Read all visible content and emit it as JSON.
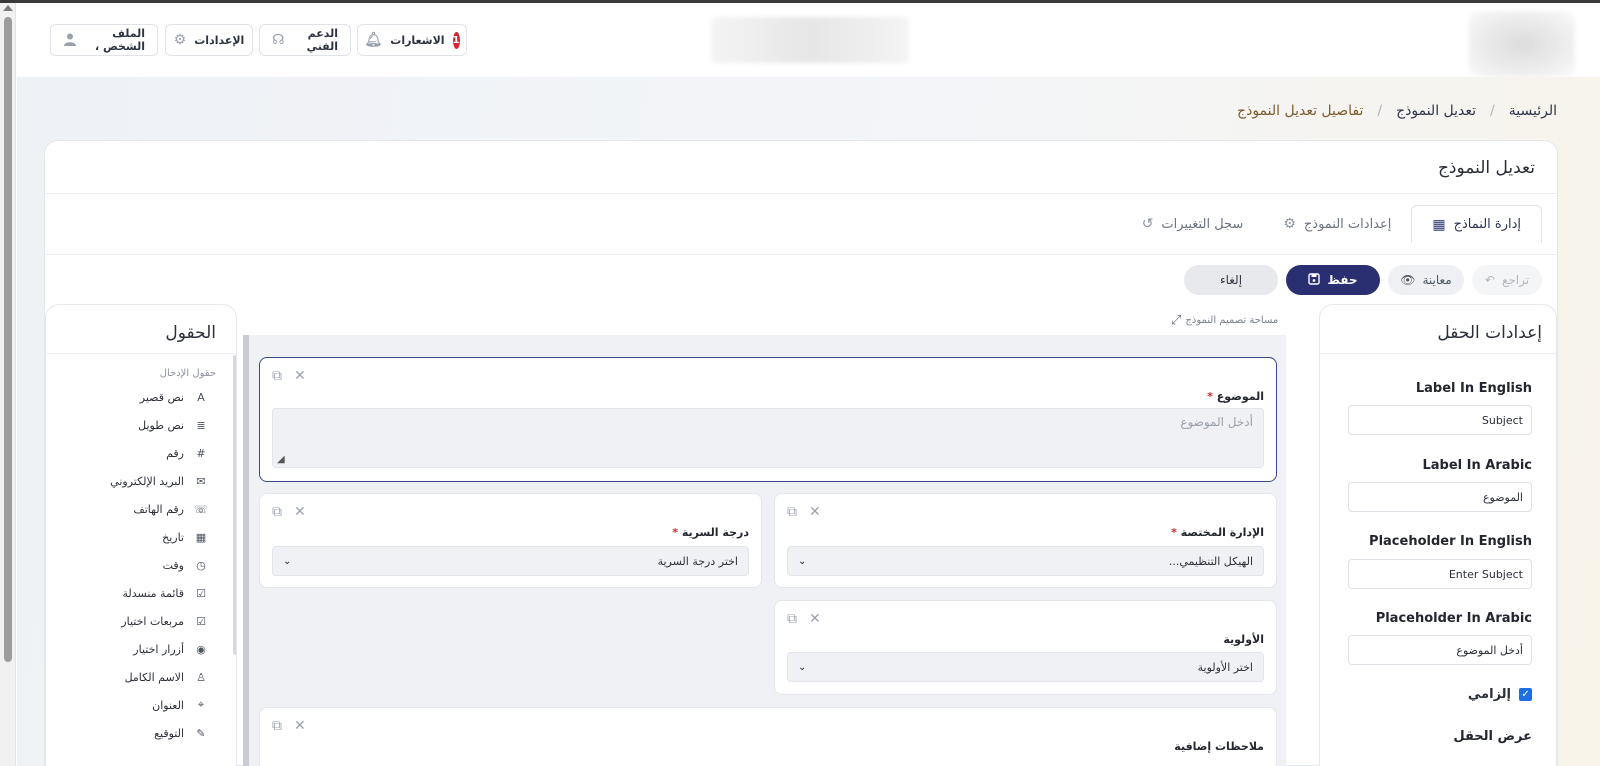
{
  "header": {
    "notifications": {
      "label": "الاشعارات",
      "count": "1"
    },
    "support": "الدعم الفني",
    "settings": "الإعدادات",
    "profile": "الملف الشخص ،"
  },
  "breadcrumb": {
    "home": "الرئيسية",
    "edit": "تعديل النموذج",
    "current": "تفاصيل تعديل النموذج"
  },
  "card": {
    "title": "تعديل النموذج",
    "tabs": [
      {
        "label": "إدارة النماذج",
        "icon": "calendar-icon",
        "active": true
      },
      {
        "label": "إعدادات النموذج",
        "icon": "gear-icon",
        "active": false
      },
      {
        "label": "سجل التغييرات",
        "icon": "history-icon",
        "active": false
      }
    ]
  },
  "toolbar": {
    "undo": "تراجع",
    "preview": "معاينة",
    "save": "حفظ",
    "cancel": "إلغاء"
  },
  "settings_panel": {
    "title": "إعدادات الحقل",
    "fields": [
      {
        "label": "Label In English",
        "value": "Subject"
      },
      {
        "label": "Label In Arabic",
        "value": "الموضوع"
      },
      {
        "label": "Placeholder In English",
        "value": "Enter Subject"
      },
      {
        "label": "Placeholder In Arabic",
        "value": "أدخل الموضوع"
      }
    ],
    "required_label": "إلزامي",
    "required_checked": true,
    "width_label": "عرض الحقل"
  },
  "design_area": {
    "label": "مساحة تصميم النموذج",
    "fields": {
      "subject": {
        "label": "الموضوع",
        "placeholder": "أدخل الموضوع"
      },
      "department": {
        "label": "الإدارة المختصة",
        "value": "الهيكل التنظيمي..."
      },
      "confidentiality": {
        "label": "درجة السرية",
        "value": "اختر درجة السرية"
      },
      "priority": {
        "label": "الأولوية",
        "value": "اختر الأولوية"
      },
      "notes": {
        "label": "ملاحظات إضافية"
      }
    }
  },
  "fields_panel": {
    "title": "الحقول",
    "section": "حقول الإدخال",
    "items": [
      {
        "label": "نص قصير",
        "icon": "A"
      },
      {
        "label": "نص طويل",
        "icon": "≣"
      },
      {
        "label": "رقم",
        "icon": "#"
      },
      {
        "label": "البريد الإلكتروني",
        "icon": "✉"
      },
      {
        "label": "رقم الهاتف",
        "icon": "☏"
      },
      {
        "label": "تاريخ",
        "icon": "▦"
      },
      {
        "label": "وقت",
        "icon": "◷"
      },
      {
        "label": "قائمة منسدلة",
        "icon": "☑"
      },
      {
        "label": "مربعات اختيار",
        "icon": "☑"
      },
      {
        "label": "أزرار اختيار",
        "icon": "◉"
      },
      {
        "label": "الاسم الكامل",
        "icon": "♙"
      },
      {
        "label": "العنوان",
        "icon": "⌖"
      },
      {
        "label": "التوقيع",
        "icon": "✎"
      }
    ]
  }
}
